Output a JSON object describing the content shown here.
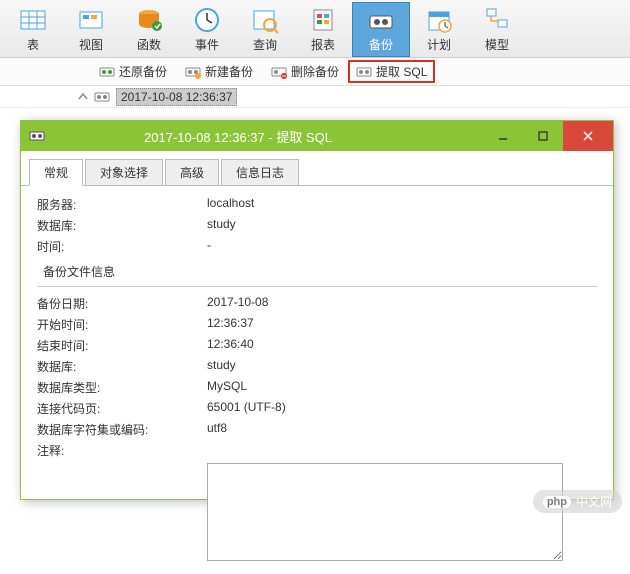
{
  "toolbar": {
    "items": [
      {
        "label": "表",
        "name": "table"
      },
      {
        "label": "视图",
        "name": "view"
      },
      {
        "label": "函数",
        "name": "function"
      },
      {
        "label": "事件",
        "name": "event"
      },
      {
        "label": "查询",
        "name": "query"
      },
      {
        "label": "报表",
        "name": "report"
      },
      {
        "label": "备份",
        "name": "backup",
        "active": true
      },
      {
        "label": "计划",
        "name": "schedule"
      },
      {
        "label": "模型",
        "name": "model"
      }
    ]
  },
  "subtoolbar": {
    "restore": "还原备份",
    "new": "新建备份",
    "delete": "删除备份",
    "extract": "提取 SQL"
  },
  "tree": {
    "item": "2017-10-08 12:36:37"
  },
  "dialog": {
    "title": "2017-10-08 12:36:37 - 提取 SQL",
    "tabs": [
      "常规",
      "对象选择",
      "高级",
      "信息日志"
    ],
    "general": {
      "server_label": "服务器:",
      "server_value": "localhost",
      "database_label": "数据库:",
      "database_value": "study",
      "time_label": "时间:",
      "time_value": "-"
    },
    "backup_section_title": "备份文件信息",
    "backup": {
      "date_label": "备份日期:",
      "date_value": "2017-10-08",
      "start_label": "开始时间:",
      "start_value": "12:36:37",
      "end_label": "结束时间:",
      "end_value": "12:36:40",
      "db_label": "数据库:",
      "db_value": "study",
      "dbtype_label": "数据库类型:",
      "dbtype_value": "MySQL",
      "codepage_label": "连接代码页:",
      "codepage_value": "65001 (UTF-8)",
      "charset_label": "数据库字符集或编码:",
      "charset_value": "utf8",
      "comment_label": "注释:"
    }
  },
  "watermark": {
    "badge": "php",
    "text": "中文网"
  }
}
